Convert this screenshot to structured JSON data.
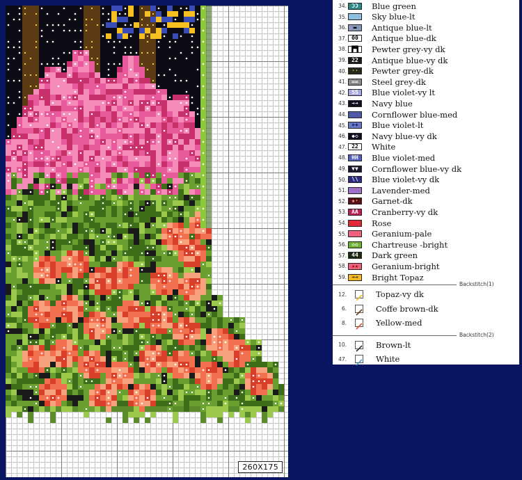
{
  "chart": {
    "size_label": "260X175",
    "colors": {
      "night": "#0b0b14",
      "tree": "#5a3a12",
      "tree_line": "#e0c050",
      "stone": "#2a2a2a",
      "pink": "#e85a9a",
      "pink_light": "#f48ab8",
      "pink_dark": "#c8306c",
      "leaf": "#6aa030",
      "leaf_dark": "#3e6e1a",
      "leaf_light": "#9ac84a",
      "rose": "#f07050",
      "rose_light": "#f7a07c",
      "rose_dark": "#d8402a",
      "border": "#8cc840",
      "yellow": "#f4c020",
      "blue": "#3a4ab8",
      "ground": "#5a8a2a"
    }
  },
  "legend": {
    "thread_rows": [
      {
        "num": "34.",
        "name": "Blue green",
        "color": "#2a8a8a",
        "symbol": "ƆƆ",
        "symbol_color": "#ffffff"
      },
      {
        "num": "35.",
        "name": "Sky blue-lt",
        "color": "#8ec0e0",
        "symbol": "",
        "symbol_color": "#000000"
      },
      {
        "num": "36.",
        "name": "Antique blue-lt",
        "color": "#8898b8",
        "symbol": "▬",
        "symbol_color": "#000000"
      },
      {
        "num": "37.",
        "name": "Antique blue-dk",
        "color": "#ffffff",
        "symbol": "00",
        "symbol_color": "#000000"
      },
      {
        "num": "38.",
        "name": "Pewter grey-vy dk",
        "color": "#ffffff",
        "symbol": "▛▜",
        "symbol_color": "#000000"
      },
      {
        "num": "39.",
        "name": "Antique blue-vy dk",
        "color": "#1a1a1a",
        "symbol": "22",
        "symbol_color": "#ffffff"
      },
      {
        "num": "40.",
        "name": "Pewter grey-dk",
        "color": "#2a2a1a",
        "symbol": "··",
        "symbol_color": "#f0d060"
      },
      {
        "num": "41.",
        "name": "Steel grey-dk",
        "color": "#888888",
        "symbol": "==",
        "symbol_color": "#ffffff"
      },
      {
        "num": "42.",
        "name": "Blue violet-vy lt",
        "color": "#a8a8e0",
        "symbol": "SS",
        "symbol_color": "#ffffff"
      },
      {
        "num": "43.",
        "name": "Navy blue",
        "color": "#101020",
        "symbol": "➔➔",
        "symbol_color": "#ffffff"
      },
      {
        "num": "44.",
        "name": "Cornflower blue-med",
        "color": "#5058a8",
        "symbol": "",
        "symbol_color": "#ffffff"
      },
      {
        "num": "45.",
        "name": "Blue violet-lt",
        "color": "#6878c8",
        "symbol": "++",
        "symbol_color": "#101040"
      },
      {
        "num": "46.",
        "name": "Navy blue-vy dk",
        "color": "#101020",
        "symbol": "◆◇",
        "symbol_color": "#ffffff"
      },
      {
        "num": "47.",
        "name": "White",
        "color": "#ffffff",
        "symbol": "22",
        "symbol_color": "#000000"
      },
      {
        "num": "48.",
        "name": "Blue violet-med",
        "color": "#5060c0",
        "symbol": "HH",
        "symbol_color": "#ffffff"
      },
      {
        "num": "49.",
        "name": "Cornflower blue-vy dk",
        "color": "#181830",
        "symbol": "▼▼",
        "symbol_color": "#ffffff"
      },
      {
        "num": "50.",
        "name": "Blue violet-vy dk",
        "color": "#2a2a80",
        "symbol": "\\\\",
        "symbol_color": "#ffffff"
      },
      {
        "num": "51.",
        "name": "Lavender-med",
        "color": "#a070c8",
        "symbol": "",
        "symbol_color": "#ffffff"
      },
      {
        "num": "52.",
        "name": "Garnet-dk",
        "color": "#5a1010",
        "symbol": "★·",
        "symbol_color": "#f0c0c0"
      },
      {
        "num": "53.",
        "name": "Cranberry-vy dk",
        "color": "#c02050",
        "symbol": "AA",
        "symbol_color": "#ffffff"
      },
      {
        "num": "54.",
        "name": "Rose",
        "color": "#e02838",
        "symbol": "",
        "symbol_color": "#ffffff"
      },
      {
        "num": "55.",
        "name": "Geranium-pale",
        "color": "#f06080",
        "symbol": "",
        "symbol_color": "#ffffff"
      },
      {
        "num": "56.",
        "name": "Chartreuse -bright",
        "color": "#70b030",
        "symbol": "◇◇",
        "symbol_color": "#ffffff"
      },
      {
        "num": "57.",
        "name": "Dark green",
        "color": "#1a2a10",
        "symbol": "44",
        "symbol_color": "#ffffff"
      },
      {
        "num": "58.",
        "name": "Geranium-bright",
        "color": "#f06078",
        "symbol": "★★",
        "symbol_color": "#701020"
      },
      {
        "num": "59.",
        "name": "Bright Topaz",
        "color": "#f4b820",
        "symbol": "➔➔",
        "symbol_color": "#202020"
      }
    ],
    "backstitch1": {
      "label": "Backstitch(1)",
      "rows": [
        {
          "num": "12.",
          "name": "Topaz-vy dk",
          "color": "#f0c020"
        },
        {
          "num": "6.",
          "name": "Coffe brown-dk",
          "color": "#6a3818"
        },
        {
          "num": "8.",
          "name": "Yellow-med",
          "color": "#e05020"
        }
      ]
    },
    "backstitch2": {
      "label": "Backstitch(2)",
      "rows": [
        {
          "num": "10.",
          "name": "Brown-lt",
          "color": "#303030"
        },
        {
          "num": "47.",
          "name": "White",
          "color": "#40a0d0"
        }
      ]
    }
  }
}
